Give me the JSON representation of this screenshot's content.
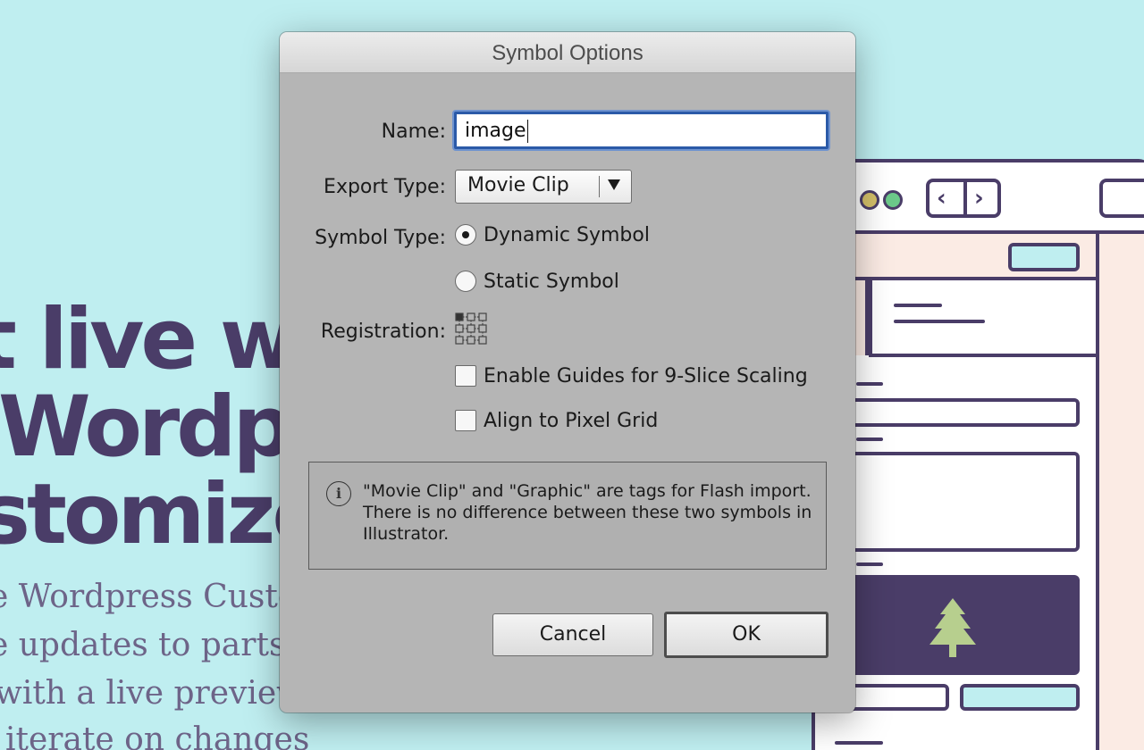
{
  "background": {
    "hero_lines": [
      "t live wi",
      "Wordpr",
      "stomize"
    ],
    "body_lines": [
      "e Wordpress Custo",
      "e updates to parts",
      "with a live preview",
      "iterate on changes"
    ]
  },
  "dialog": {
    "title": "Symbol Options",
    "name_label": "Name:",
    "name_value": "image",
    "export_type_label": "Export Type:",
    "export_type_value": "Movie Clip",
    "symbol_type_label": "Symbol Type:",
    "symbol_type_options": [
      {
        "label": "Dynamic Symbol",
        "selected": true
      },
      {
        "label": "Static Symbol",
        "selected": false
      }
    ],
    "registration_label": "Registration:",
    "registration_selected": "top-left",
    "checkboxes": [
      {
        "label": "Enable Guides for 9-Slice Scaling",
        "checked": false
      },
      {
        "label": "Align to Pixel Grid",
        "checked": false
      }
    ],
    "info_icon": "info-icon",
    "info_text": "\"Movie Clip\" and \"Graphic\" are tags for Flash import. There is no difference between these two symbols in Illustrator.",
    "cancel_label": "Cancel",
    "ok_label": "OK"
  },
  "colors": {
    "background": "#bfeef0",
    "hero_text": "#4a3d68",
    "dialog_bg": "#b5b5b5",
    "focus_ring": "#2b5aa8"
  }
}
